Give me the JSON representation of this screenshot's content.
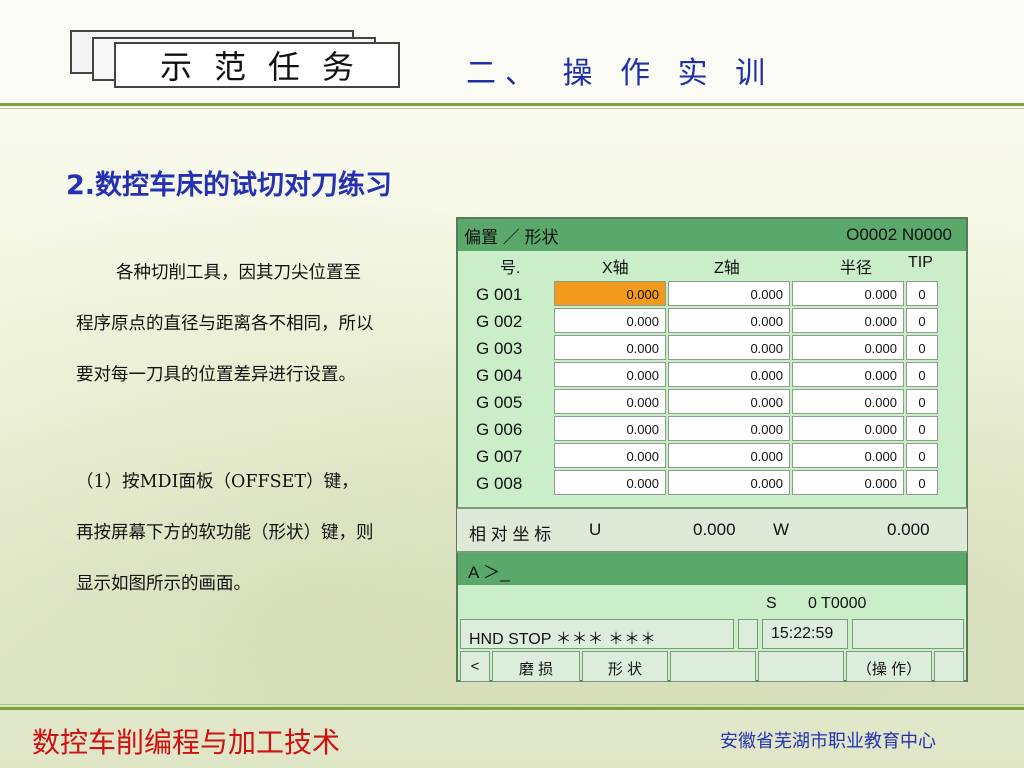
{
  "header": {
    "badge_text": "示范任务",
    "section_title": "二、 操 作 实 训"
  },
  "main": {
    "heading": "2.数控车床的试切对刀练习",
    "paragraph1": "各种切削工具，因其刀尖位置至程序原点的直径与距离各不相同，所以要对每一刀具的位置差异进行设置。",
    "paragraph2": "（1）按MDI面板（OFFSET）键，再按屏幕下方的软功能（形状）键，则显示如图所示的画面。"
  },
  "cnc": {
    "title_left": "偏置 ／ 形状",
    "title_right": "O0002  N0000",
    "columns": {
      "no": "号.",
      "x": "X轴",
      "z": "Z轴",
      "radius": "半径",
      "tip": "TIP"
    },
    "rows": [
      {
        "no": "G 001",
        "x": "0.000",
        "z": "0.000",
        "r": "0.000",
        "tip": "0"
      },
      {
        "no": "G 002",
        "x": "0.000",
        "z": "0.000",
        "r": "0.000",
        "tip": "0"
      },
      {
        "no": "G 003",
        "x": "0.000",
        "z": "0.000",
        "r": "0.000",
        "tip": "0"
      },
      {
        "no": "G 004",
        "x": "0.000",
        "z": "0.000",
        "r": "0.000",
        "tip": "0"
      },
      {
        "no": "G 005",
        "x": "0.000",
        "z": "0.000",
        "r": "0.000",
        "tip": "0"
      },
      {
        "no": "G 006",
        "x": "0.000",
        "z": "0.000",
        "r": "0.000",
        "tip": "0"
      },
      {
        "no": "G 007",
        "x": "0.000",
        "z": "0.000",
        "r": "0.000",
        "tip": "0"
      },
      {
        "no": "G 008",
        "x": "0.000",
        "z": "0.000",
        "r": "0.000",
        "tip": "0"
      }
    ],
    "relative": {
      "label": "相 对 坐 标",
      "u_label": "U",
      "u_value": "0.000",
      "w_label": "W",
      "w_value": "0.000"
    },
    "command_prompt": "A ＞_",
    "spindle": {
      "s_label": "S",
      "s_value": "0 T0000"
    },
    "status": {
      "mode": "HND   STOP  ＊＊＊ ＊＊＊",
      "time": "15:22:59"
    },
    "softkeys": {
      "left_arrow": "<",
      "wear": "磨 损",
      "shape": "形 状",
      "operate": "（操 作）"
    }
  },
  "footer": {
    "left": "数控车削编程与加工技术",
    "right": "安徽省芜湖市职业教育中心"
  },
  "colors": {
    "accent_green": "#5aa96a",
    "screen_bg": "#c9eec8",
    "highlight_cell": "#f29a1b",
    "title_blue": "#2431b3",
    "footer_red": "#d01010"
  }
}
